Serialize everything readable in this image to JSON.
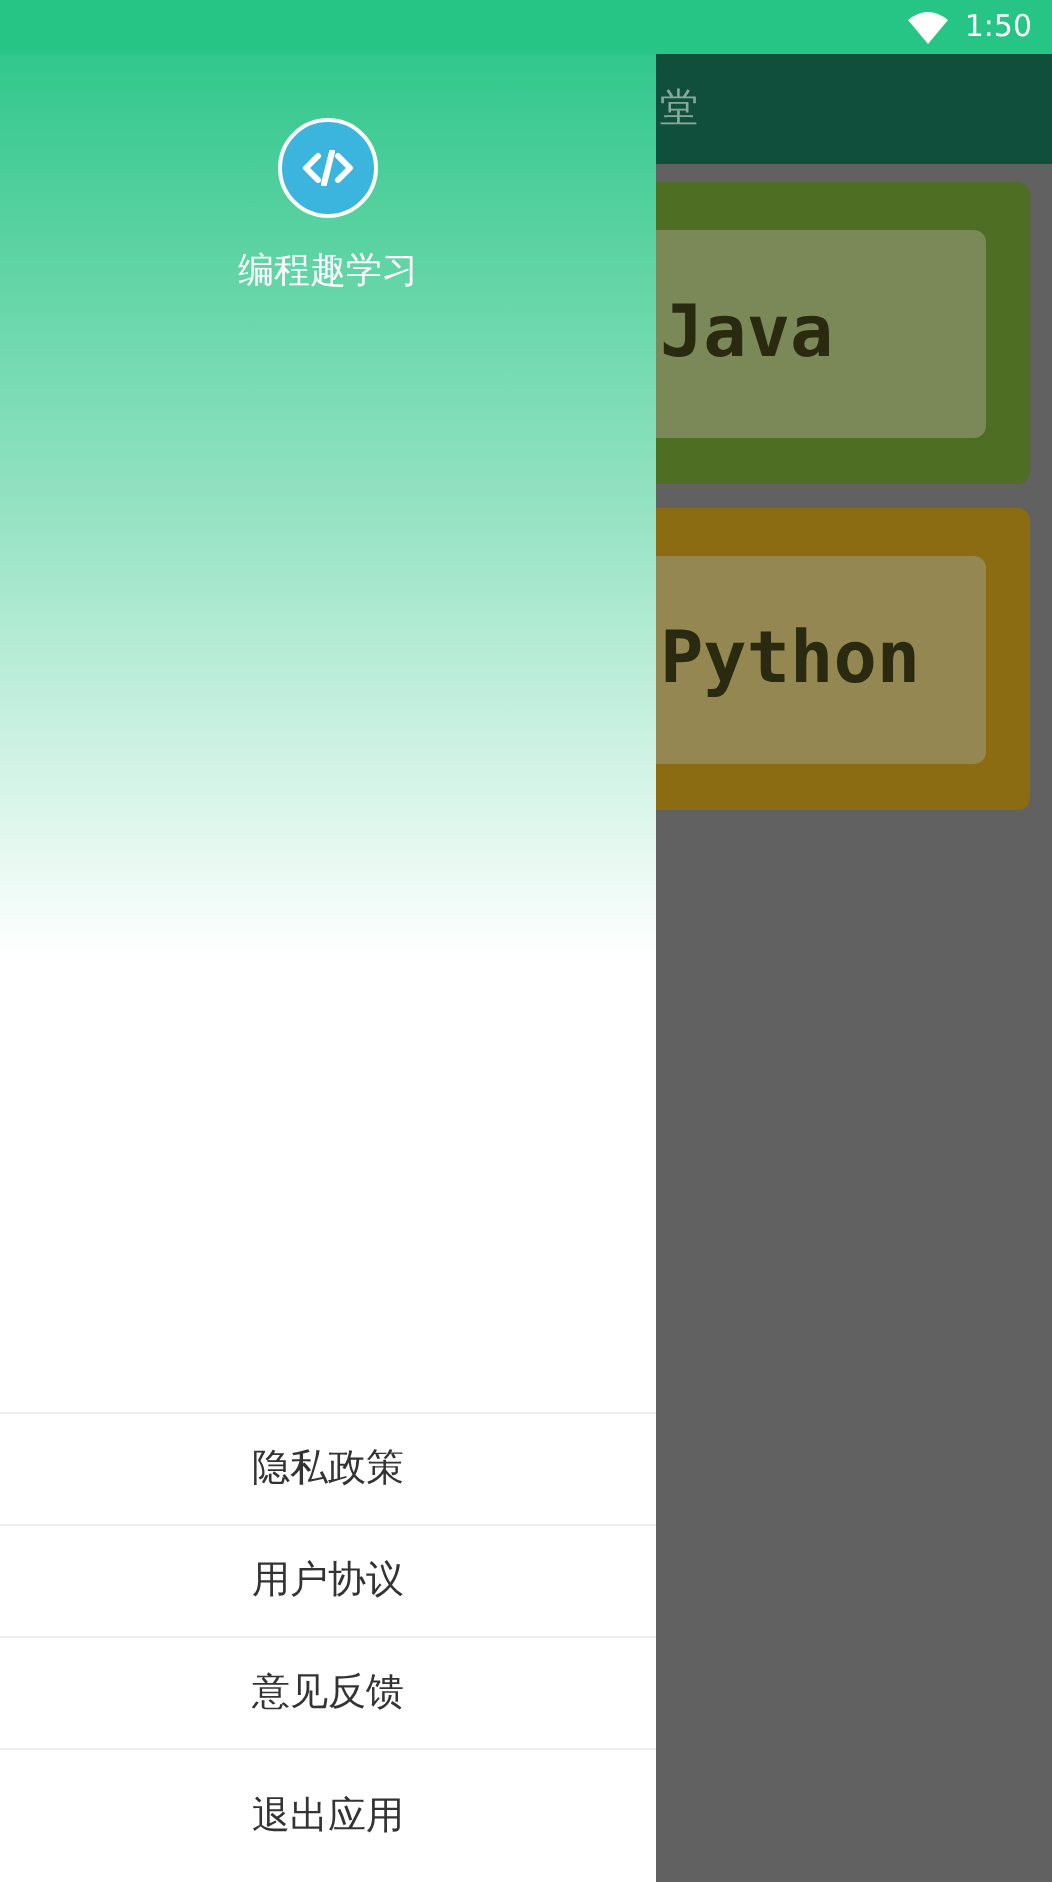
{
  "status_bar": {
    "time": "1:50"
  },
  "page": {
    "title": "堂",
    "cards": [
      {
        "label": "Java",
        "color": "#4e6e24"
      },
      {
        "label": "Python",
        "color": "#8c6c12"
      }
    ]
  },
  "drawer": {
    "app_name": "编程趣学习",
    "menu": [
      "隐私政策",
      "用户协议",
      "意见反馈",
      "退出应用"
    ]
  }
}
